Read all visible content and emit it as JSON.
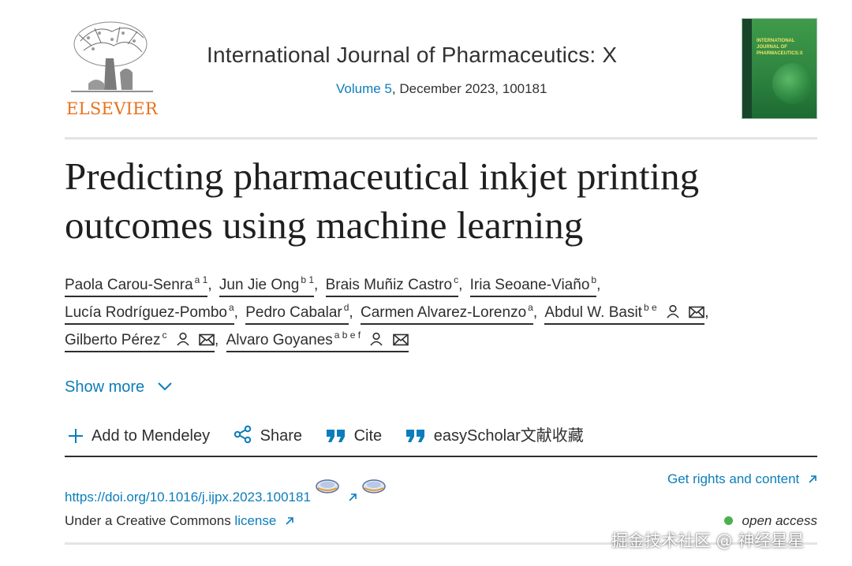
{
  "header": {
    "publisher_logo_text": "ELSEVIER",
    "journal_title": "International Journal of Pharmaceutics: X",
    "volume_link": "Volume 5",
    "issue_rest": ", December 2023, 100181",
    "cover_text": "INTERNATIONAL JOURNAL OF PHARMACEUTICS:X"
  },
  "article": {
    "title": "Predicting pharmaceutical inkjet printing outcomes using machine learning"
  },
  "authors": [
    {
      "name": "Paola Carou-Senra",
      "aff": "a 1"
    },
    {
      "name": "Jun Jie Ong",
      "aff": "b 1"
    },
    {
      "name": "Brais Muñiz Castro",
      "aff": "c"
    },
    {
      "name": "Iria Seoane-Viaño",
      "aff": "b"
    },
    {
      "name": "Lucía Rodríguez-Pombo",
      "aff": "a"
    },
    {
      "name": "Pedro Cabalar",
      "aff": "d"
    },
    {
      "name": "Carmen Alvarez-Lorenzo",
      "aff": "a"
    },
    {
      "name": "Abdul W. Basit",
      "aff": "b e"
    },
    {
      "name": "Gilberto Pérez",
      "aff": "c"
    },
    {
      "name": "Alvaro Goyanes",
      "aff": "a b e f"
    }
  ],
  "punct": {
    "comma": ","
  },
  "show_more": "Show more",
  "actions": {
    "mendeley": "Add to Mendeley",
    "share": "Share",
    "cite": "Cite",
    "easyscholar": "easyScholar文献收藏"
  },
  "doi": "https://doi.org/10.1016/j.ijpx.2023.100181",
  "rights": "Get rights and content",
  "license_prefix": "Under a Creative Commons ",
  "license_link": "license",
  "open_access": "open access",
  "watermark": "掘金技术社区 @ 神经星星",
  "colors": {
    "link": "#0c7dbb",
    "elsevier_orange": "#e9711c",
    "open_access_dot": "#4caf50"
  },
  "icons": [
    "person-icon",
    "envelope-icon",
    "chevron-down-icon",
    "plus-icon",
    "share-icon",
    "quote-icon",
    "external-link-icon"
  ]
}
